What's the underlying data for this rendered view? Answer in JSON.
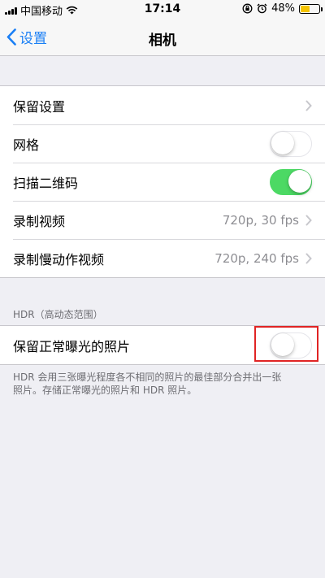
{
  "status_bar": {
    "carrier": "中国移动",
    "time": "17:14",
    "battery_percent": "48%",
    "battery_level": 0.48,
    "battery_color": "#f5c400"
  },
  "nav": {
    "back_label": "设置",
    "title": "相机"
  },
  "group1": {
    "rows": [
      {
        "label": "保留设置",
        "value": "",
        "control": "chevron"
      },
      {
        "label": "网格",
        "control": "toggle",
        "on": false
      },
      {
        "label": "扫描二维码",
        "control": "toggle",
        "on": true
      },
      {
        "label": "录制视频",
        "value": "720p, 30 fps",
        "control": "chevron"
      },
      {
        "label": "录制慢动作视频",
        "value": "720p, 240 fps",
        "control": "chevron"
      }
    ]
  },
  "hdr_section": {
    "header": "HDR（高动态范围）",
    "row_label": "保留正常曝光的照片",
    "toggle_on": false,
    "footer_line1": "HDR 会用三张曝光程度各不相同的照片的最佳部分合并出一张",
    "footer_line2": "照片。存储正常曝光的照片和 HDR 照片。"
  },
  "colors": {
    "accent": "#1a7ff5",
    "toggle_on": "#4cd964",
    "highlight_box": "#e02424"
  },
  "icons": [
    "wifi-icon",
    "orientation-lock-icon",
    "alarm-icon",
    "battery-icon",
    "back-chevron-icon",
    "chevron-right-icon"
  ]
}
